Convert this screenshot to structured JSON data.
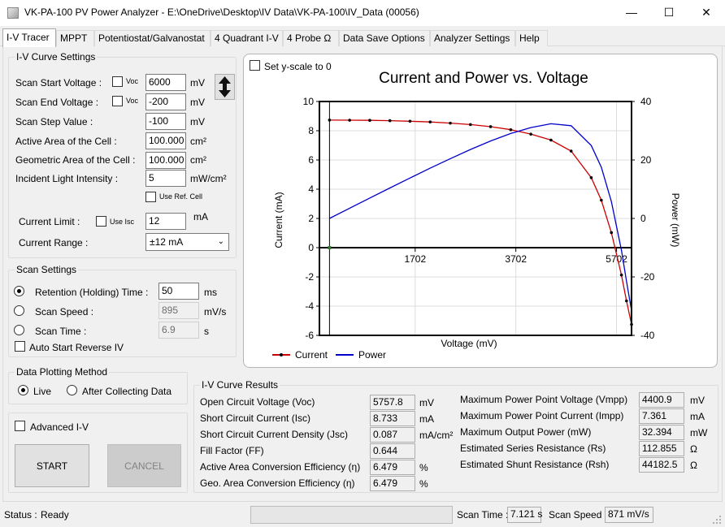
{
  "window": {
    "title": "VK-PA-100 PV Power Analyzer - E:\\OneDrive\\Desktop\\IV Data\\VK-PA-100\\IV_Data (00056)",
    "minimize_glyph": "—",
    "maximize_glyph": "☐",
    "close_glyph": "✕"
  },
  "tabs": [
    "I-V Tracer",
    "MPPT",
    "Potentiostat/Galvanostat",
    "4 Quadrant I-V",
    "4 Probe Ω",
    "Data Save Options",
    "Analyzer Settings",
    "Help"
  ],
  "iv_settings": {
    "title": "I-V Curve Settings",
    "start_label": "Scan Start Voltage :",
    "end_label": "Scan End Voltage :",
    "step_label": "Scan Step Value :",
    "active_label": "Active Area of the Cell :",
    "geo_label": "Geometric Area of the Cell :",
    "light_label": "Incident Light Intensity :",
    "voc_label": "Voc",
    "start_value": "6000",
    "end_value": "-200",
    "step_value": "-100",
    "active_value": "100.000",
    "geo_value": "100.000",
    "light_value": "5",
    "unit_mv": "mV",
    "unit_cm2": "cm²",
    "unit_light": "mW/cm²",
    "use_ref_label": "Use Ref. Cell",
    "current_limit_label": "Current Limit :",
    "use_isc_label": "Use Isc",
    "current_limit_value": "12",
    "unit_ma": "mA",
    "current_range_label": "Current Range :",
    "current_range_value": "±12 mA",
    "swap_icon": "up-down-arrow-icon"
  },
  "scan_settings": {
    "title": "Scan Settings",
    "retention_label": "Retention (Holding) Time :",
    "retention_value": "50",
    "retention_unit": "ms",
    "speed_label": "Scan Speed :",
    "speed_value": "895",
    "speed_unit": "mV/s",
    "time_label": "Scan Time :",
    "time_value": "6.9",
    "time_unit": "s",
    "auto_reverse_label": "Auto Start Reverse IV"
  },
  "plotting": {
    "title": "Data Plotting Method",
    "live_label": "Live",
    "after_label": "After Collecting Data"
  },
  "advanced": {
    "label": "Advanced I-V"
  },
  "buttons": {
    "start": "START",
    "cancel": "CANCEL"
  },
  "chart": {
    "set_yscale_label": "Set y-scale to 0"
  },
  "chart_data": {
    "type": "line",
    "title": "Current and Power vs. Voltage",
    "xlabel": "Voltage (mV)",
    "ylabel": "Current (mA)",
    "y2label": "Power (mW)",
    "xlim": [
      -200,
      6000
    ],
    "ylim": [
      -6,
      10
    ],
    "y2lim": [
      -40,
      40
    ],
    "xticks": [
      1702,
      3702,
      5702
    ],
    "yticks": [
      -6,
      -4,
      -2,
      0,
      2,
      4,
      6,
      8,
      10
    ],
    "y2ticks": [
      -40,
      -20,
      0,
      20,
      40
    ],
    "grid": true,
    "legend": "bottom-left",
    "series": [
      {
        "name": "Current",
        "color": "#cc0000",
        "axis": "left",
        "markers": true,
        "x": [
          0,
          400,
          800,
          1200,
          1600,
          2000,
          2400,
          2800,
          3200,
          3600,
          4000,
          4400,
          4800,
          5200,
          5400,
          5600,
          5800,
          5900,
          6000
        ],
        "y": [
          8.73,
          8.72,
          8.71,
          8.69,
          8.65,
          8.6,
          8.52,
          8.42,
          8.28,
          8.07,
          7.77,
          7.36,
          6.61,
          4.79,
          3.25,
          1.03,
          -1.87,
          -3.64,
          -5.25
        ]
      },
      {
        "name": "Power",
        "color": "#0000cc",
        "axis": "right",
        "markers": false,
        "x": [
          0,
          400,
          800,
          1200,
          1600,
          2000,
          2400,
          2800,
          3200,
          3600,
          4000,
          4400,
          4800,
          5200,
          5400,
          5600,
          5800,
          5900,
          6000
        ],
        "y": [
          0,
          3.49,
          6.97,
          10.43,
          13.84,
          17.2,
          20.45,
          23.58,
          26.5,
          29.05,
          31.08,
          32.39,
          31.73,
          24.91,
          17.55,
          5.77,
          -10.85,
          -21.48,
          -31.5
        ]
      }
    ]
  },
  "results": {
    "title": "I-V Curve Results",
    "left": [
      {
        "label": "Open Circuit Voltage (Voc)",
        "value": "5757.8",
        "unit": "mV"
      },
      {
        "label": "Short Circuit Current (Isc)",
        "value": "8.733",
        "unit": "mA"
      },
      {
        "label": "Short Circuit Current Density (Jsc)",
        "value": "0.087",
        "unit": "mA/cm²"
      },
      {
        "label": "Fill Factor (FF)",
        "value": "0.644",
        "unit": ""
      },
      {
        "label": "Active Area Conversion Efficiency (η)",
        "value": "6.479",
        "unit": "%"
      },
      {
        "label": "Geo. Area Conversion Efficiency (η)",
        "value": "6.479",
        "unit": "%"
      }
    ],
    "right": [
      {
        "label": "Maximum Power Point Voltage (Vmpp)",
        "value": "4400.9",
        "unit": "mV"
      },
      {
        "label": "Maximum Power Point Current (Impp)",
        "value": "7.361",
        "unit": "mA"
      },
      {
        "label": "Maximum Output Power (mW)",
        "value": "32.394",
        "unit": "mW"
      },
      {
        "label": "Estimated Series Resistance (Rs)",
        "value": "112.855",
        "unit": "Ω"
      },
      {
        "label": "Estimated Shunt Resistance (Rsh)",
        "value": "44182.5",
        "unit": "Ω"
      }
    ]
  },
  "status": {
    "status_label": "Status :",
    "status_value": "Ready",
    "scan_time_label": "Scan Time :",
    "scan_time_value": "7.121 s",
    "scan_speed_label": "Scan Speed :",
    "scan_speed_value": "871 mV/s"
  }
}
